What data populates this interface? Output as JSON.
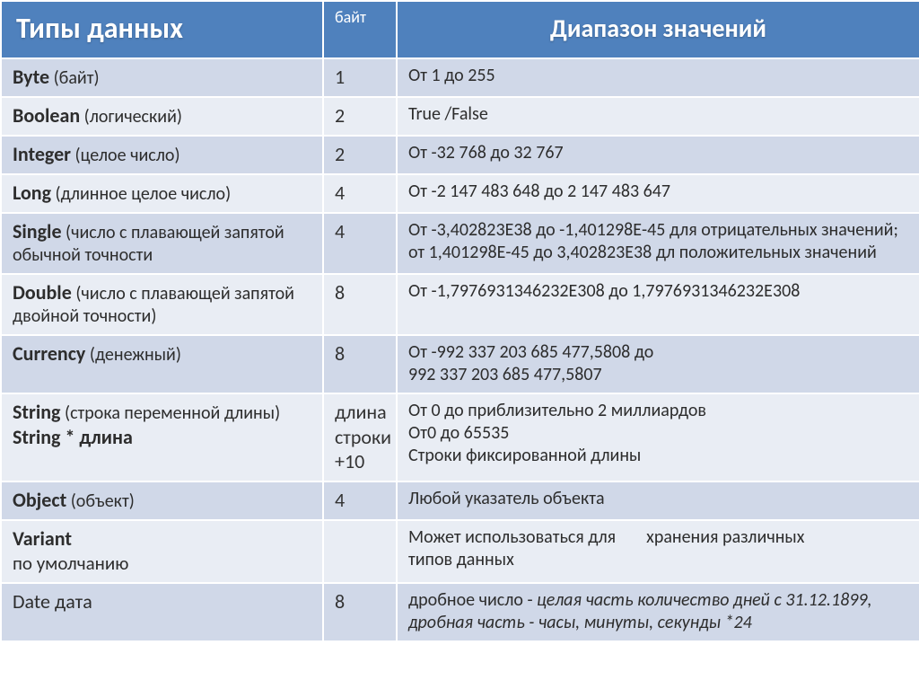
{
  "headers": {
    "types": "Типы данных",
    "bytes": "байт",
    "range": "Диапазон значений"
  },
  "rows": {
    "byte": {
      "name": "Byte",
      "desc": " (байт)",
      "bytes": "1",
      "range": "От 1 до 255"
    },
    "boolean": {
      "name": "Boolean",
      "desc": " (логический)",
      "bytes": "2",
      "range": "True /False"
    },
    "integer": {
      "name": "Integer",
      "desc": " (целое число)",
      "bytes": "2",
      "range": "От -32 768 до 32 767"
    },
    "long": {
      "name": "Long",
      "desc": " (длинное целое число)",
      "bytes": "4",
      "range": "От -2 147 483 648 до 2 147 483 647"
    },
    "single": {
      "name": "Single",
      "desc": " (число с плавающей запятой обычной точности",
      "bytes": "4",
      "range1": "От -3,402823Е38 до -1,401298Е-45 для отрицательных значений;",
      "range2": "от 1,401298Е-45 до 3,402823Е38 дл положительных значений"
    },
    "double": {
      "name": "Double",
      "desc": " (число с плавающей запятой двойной точности)",
      "bytes": "8",
      "range": "От -1,7976931346232Е308 до 1,7976931346232Е308"
    },
    "currency": {
      "name": "Currency",
      "desc": " (денежный)",
      "bytes": "8",
      "range1": "От -992 337 203 685 477,5808 до",
      "range2": "992 337 203 685 477,5807"
    },
    "string": {
      "name": "String",
      "desc": " (строка переменной длины)",
      "name2": "String * длина",
      "bytes": "длина строки +10",
      "range1": "От 0 до приблизительно 2 миллиардов",
      "range2": "От0 до 65535",
      "range3": "Строки фиксированной длины"
    },
    "object": {
      "name": "Object",
      "desc": " (объект)",
      "bytes": "4",
      "range": "Любой указатель объекта"
    },
    "variant": {
      "name": "Variant",
      "extra": "по умолчанию",
      "bytes": "",
      "range1a": "Может использоваться для",
      "range1b": "хранения различных",
      "range2": "типов данных"
    },
    "date": {
      "name": "Date  дата",
      "bytes": "8",
      "range1a": "дробное число - ",
      "range1b": "целая часть количество дней с 31.12.1899, дробная часть - часы, минуты, секунды *24"
    }
  }
}
